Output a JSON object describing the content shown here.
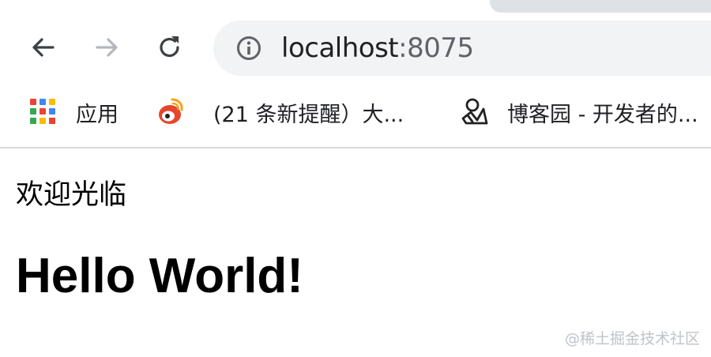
{
  "toolbar": {
    "url_host": "localhost",
    "url_port": ":8075"
  },
  "bookmarks": {
    "items": [
      {
        "label": "应用",
        "icon": "apps-grid-icon"
      },
      {
        "label": "(21 条新提醒）大...",
        "icon": "weibo-icon"
      },
      {
        "label": "博客园 - 开发者的...",
        "icon": "cnblogs-icon"
      }
    ]
  },
  "page": {
    "welcome": "欢迎光临",
    "heading": "Hello World!"
  },
  "watermark": "@稀土掘金技术社区",
  "colors": {
    "omnibox_bg": "#f1f3f4",
    "tab_bg": "#dee1e6",
    "apps_grid": [
      "#ea4335",
      "#4285f4",
      "#fbbc05",
      "#34a853",
      "#ea4335",
      "#4285f4",
      "#34a853",
      "#fbbc05",
      "#ea4335"
    ]
  }
}
